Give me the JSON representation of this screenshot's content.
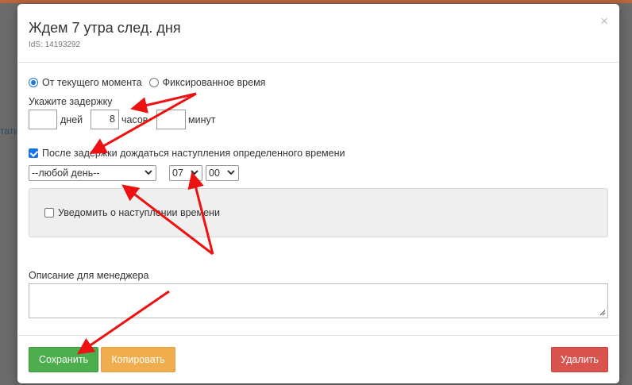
{
  "background": {
    "left_text": "тати"
  },
  "modal": {
    "title": "Ждем 7 утра след. дня",
    "ids": "IdS: 14193292",
    "close_glyph": "×"
  },
  "mode": {
    "option_current": "От текущего момента",
    "option_fixed": "Фиксированное время",
    "selected": "option_current"
  },
  "delay": {
    "label": "Укажите задержку",
    "days_value": "",
    "days_unit": "дней",
    "hours_value": "8",
    "hours_unit": "часов",
    "minutes_value": "",
    "minutes_unit": "минут"
  },
  "wait": {
    "checkbox_label": "После задержки дождаться наступления определенного времени",
    "checked": true,
    "day_select": "--любой день--",
    "hour_select": "07",
    "minute_select": "00"
  },
  "notify": {
    "label": "Уведомить о наступлении времени",
    "checked": false
  },
  "description": {
    "label": "Описание для менеджера",
    "value": ""
  },
  "buttons": {
    "save": "Сохранить",
    "copy": "Копировать",
    "delete": "Удалить"
  },
  "colors": {
    "save": "#4cae4c",
    "copy": "#f0ad4e",
    "delete": "#d9534f",
    "annotation_arrow": "#ee1111",
    "accent": "#1a73e8"
  },
  "icons": {
    "close": "close-icon",
    "chevron": "chevron-down-icon",
    "resize": "resize-grip-icon"
  }
}
